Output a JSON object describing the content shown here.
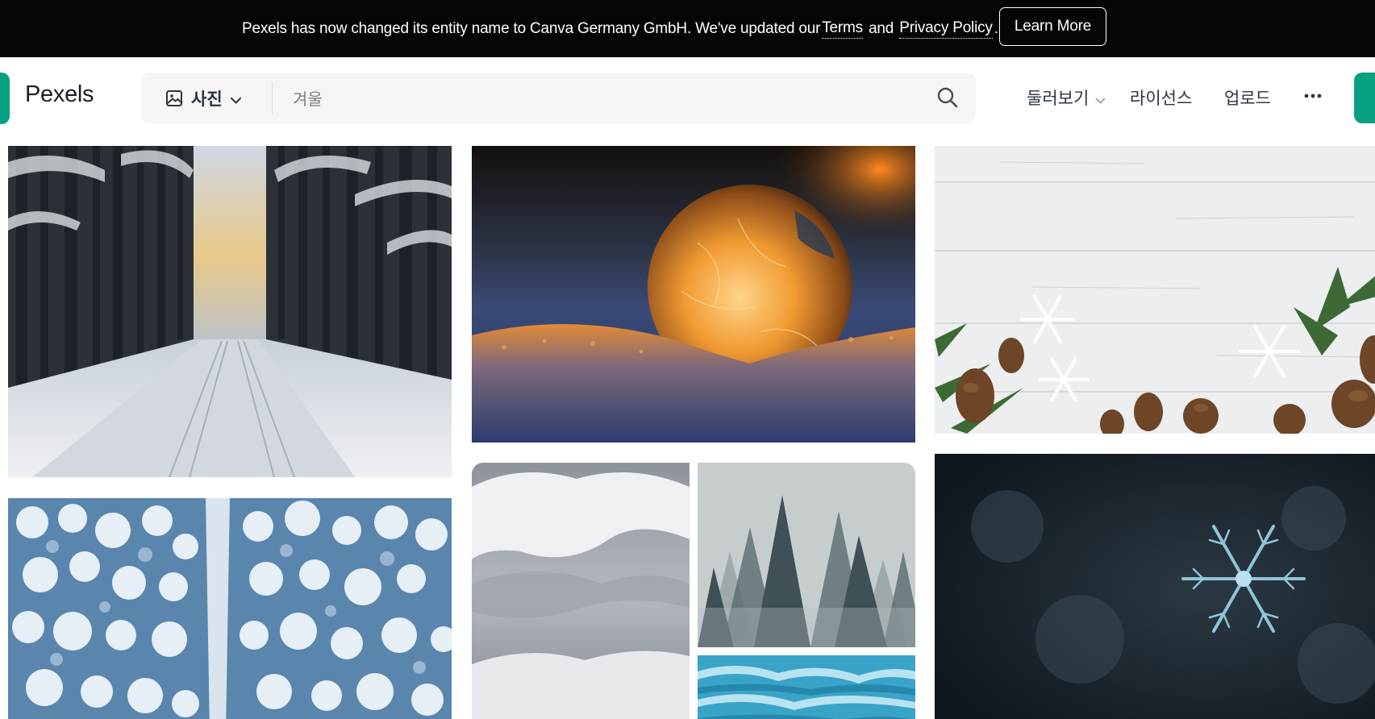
{
  "banner": {
    "text_before": "Pexels has now changed its entity name to Canva Germany GmbH. We've updated our ",
    "terms_label": "Terms",
    "and_text": " and ",
    "privacy_label": "Privacy Policy",
    "period": ".",
    "learn_more_label": "Learn More"
  },
  "header": {
    "logo_text": "Pexels",
    "search": {
      "type_label": "사진",
      "type_icon": "image-icon",
      "query": "겨울",
      "button_icon": "search-icon"
    },
    "nav": {
      "explore_label": "둘러보기",
      "license_label": "라이선스",
      "upload_label": "업로드",
      "more_icon": "more-horizontal-icon"
    }
  },
  "photos": [
    {
      "subject": "snowy-forest-road"
    },
    {
      "subject": "frozen-bubble-sunset"
    },
    {
      "subject": "white-wood-pinecones-snowflakes"
    },
    {
      "subject": "aerial-snowy-forest-road"
    },
    {
      "subject": "snowy-clouds-sky"
    },
    {
      "subject": "misty-pine-forest"
    },
    {
      "subject": "blue-ice-glacier"
    },
    {
      "subject": "snowflake-macro"
    }
  ],
  "colors": {
    "brand": "#07a081",
    "banner_bg": "#050505",
    "search_bg": "#f5f5f5",
    "text": "#2c343e"
  }
}
